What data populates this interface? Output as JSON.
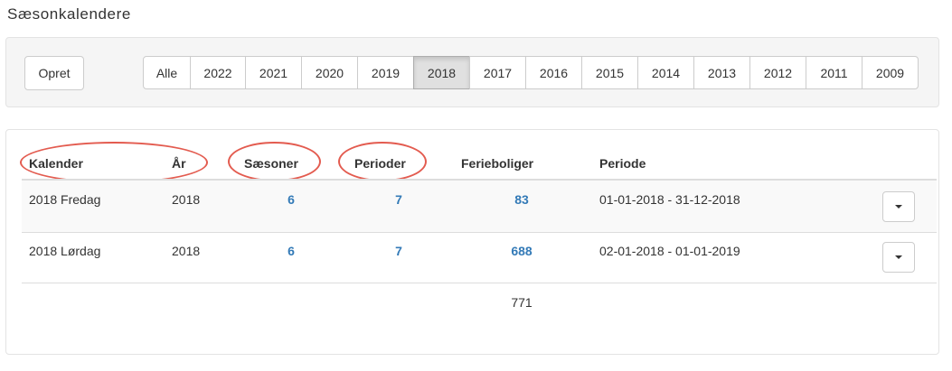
{
  "page": {
    "title": "Sæsonkalendere"
  },
  "toolbar": {
    "create_label": "Opret",
    "year_filters": [
      "Alle",
      "2022",
      "2021",
      "2020",
      "2019",
      "2018",
      "2017",
      "2016",
      "2015",
      "2014",
      "2013",
      "2012",
      "2011",
      "2009"
    ],
    "active_filter": "2018"
  },
  "table": {
    "columns": [
      "Kalender",
      "År",
      "Sæsoner",
      "Perioder",
      "Ferieboliger",
      "Periode"
    ],
    "rows": [
      {
        "kalender": "2018 Fredag",
        "aar": "2018",
        "saesoner": "6",
        "perioder": "7",
        "ferieboliger": "83",
        "periode": "01-01-2018 - 31-12-2018"
      },
      {
        "kalender": "2018 Lørdag",
        "aar": "2018",
        "saesoner": "6",
        "perioder": "7",
        "ferieboliger": "688",
        "periode": "02-01-2018 - 01-01-2019"
      }
    ],
    "total_ferieboliger": "771"
  },
  "colors": {
    "link": "#337ab7",
    "annotation": "#e35b4f",
    "active_bg": "#e0e0e0"
  }
}
